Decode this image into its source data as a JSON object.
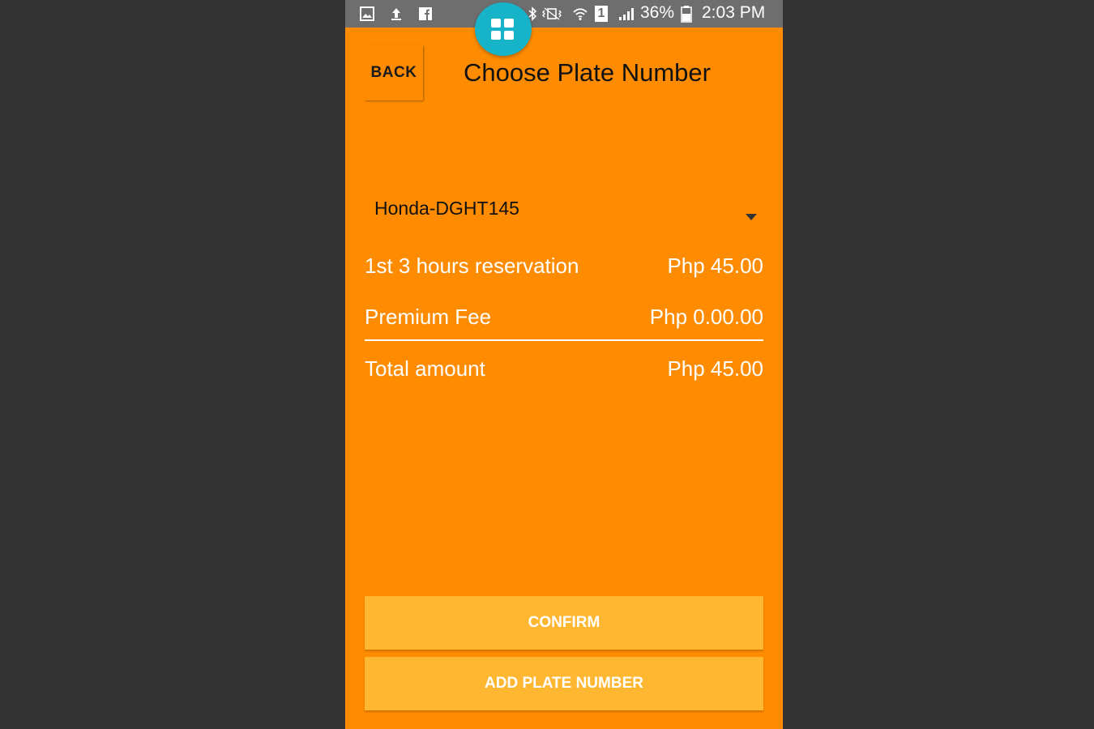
{
  "status_bar": {
    "icons": [
      "gallery-icon",
      "upload-icon",
      "facebook-icon",
      "bluetooth-icon",
      "vibrate-icon",
      "wifi-icon",
      "sim-icon",
      "signal-icon",
      "battery-icon"
    ],
    "sim_number": "1",
    "battery_percent": "36%",
    "time": "2:03 PM"
  },
  "fab": {
    "icon": "grid-icon",
    "color": "#17b3c9"
  },
  "header": {
    "back_label": "BACK",
    "title": "Choose Plate Number"
  },
  "plate_select": {
    "selected": "Honda-DGHT145"
  },
  "summary": {
    "reservation_label": "1st 3 hours reservation",
    "reservation_amount": "Php 45.00",
    "premium_label": "Premium Fee",
    "premium_amount": "Php 0.00.00",
    "total_label": "Total amount",
    "total_amount": "Php 45.00"
  },
  "actions": {
    "confirm_label": "CONFIRM",
    "add_plate_label": "ADD PLATE NUMBER"
  },
  "colors": {
    "background": "#FF8C00",
    "button": "#FFB732",
    "statusbar": "#6e6e6e"
  }
}
